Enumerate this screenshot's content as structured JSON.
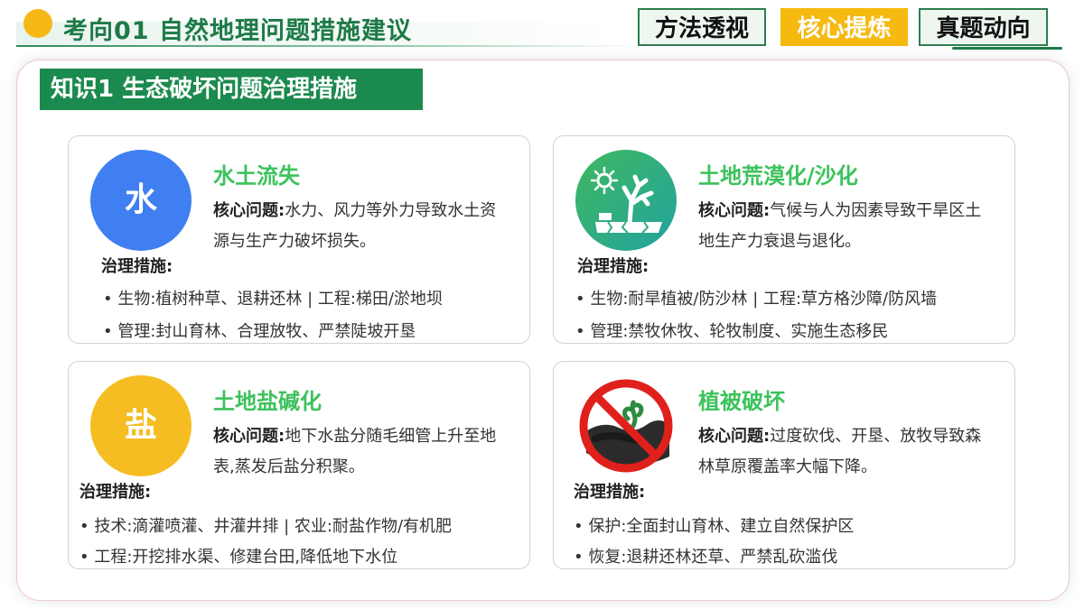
{
  "header": {
    "title": "考向01  自然地理问题措施建议",
    "tabs": [
      {
        "label": "方法透视",
        "active": false
      },
      {
        "label": "核心提炼",
        "active": true
      },
      {
        "label": "真题动向",
        "active": false
      }
    ]
  },
  "section": {
    "title": "知识1  生态破坏问题治理措施"
  },
  "measures_label": "治理措施:",
  "core_label": "核心问题:",
  "cards": [
    {
      "icon_text": "水",
      "icon": "water-circle-icon",
      "title": "水土流失",
      "core": "水力、风力等外力导致水土资源与生产力破坏损失。",
      "bullets": [
        "• 生物:植树种草、退耕还林 | 工程:梯田/淤地坝",
        "• 管理:封山育林、合理放牧、严禁陡坡开垦"
      ]
    },
    {
      "icon": "desertification-icon",
      "title": "土地荒漠化/沙化",
      "core": "气候与人为因素导致干旱区土地生产力衰退与退化。",
      "bullets": [
        "• 生物:耐旱植被/防沙林 | 工程:草方格沙障/防风墙",
        "• 管理:禁牧休牧、轮牧制度、实施生态移民"
      ]
    },
    {
      "icon_text": "盐",
      "icon": "salt-circle-icon",
      "title": "土地盐碱化",
      "core": "地下水盐分随毛细管上升至地表,蒸发后盐分积聚。",
      "bullets": [
        "• 技术:滴灌喷灌、井灌井排 | 农业:耐盐作物/有机肥",
        "• 工程:开挖排水渠、修建台田,降低地下水位"
      ]
    },
    {
      "icon": "no-deforestation-icon",
      "title": "植被破坏",
      "core": "过度砍伐、开垦、放牧导致森林草原覆盖率大幅下降。",
      "bullets": [
        "• 保护:全面封山育林、建立自然保护区",
        "• 恢复:退耕还林还草、严禁乱砍滥伐"
      ]
    }
  ],
  "colors": {
    "brand_green": "#1b8a4e",
    "accent_yellow": "#f5b90f",
    "card_title_green": "#3cc25c",
    "water_blue": "#3f7ff1",
    "salt_yellow": "#f6bd22",
    "prohibit_red": "#e0201b"
  }
}
